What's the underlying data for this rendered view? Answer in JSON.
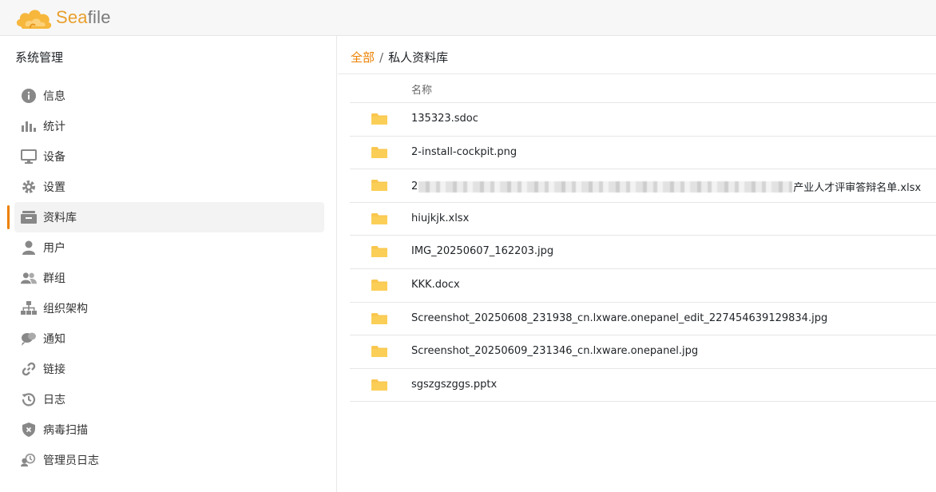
{
  "app": {
    "logo_text_a": "Sea",
    "logo_text_b": "file"
  },
  "sidebar": {
    "title": "系统管理",
    "items": [
      {
        "label": "信息",
        "icon": "info-icon"
      },
      {
        "label": "统计",
        "icon": "bar-chart-icon"
      },
      {
        "label": "设备",
        "icon": "monitor-icon"
      },
      {
        "label": "设置",
        "icon": "gear-icon"
      },
      {
        "label": "资料库",
        "icon": "library-icon",
        "active": true
      },
      {
        "label": "用户",
        "icon": "user-icon"
      },
      {
        "label": "群组",
        "icon": "group-icon"
      },
      {
        "label": "组织架构",
        "icon": "org-chart-icon"
      },
      {
        "label": "通知",
        "icon": "notification-icon"
      },
      {
        "label": "链接",
        "icon": "link-icon"
      },
      {
        "label": "日志",
        "icon": "history-icon"
      },
      {
        "label": "病毒扫描",
        "icon": "shield-icon"
      },
      {
        "label": "管理员日志",
        "icon": "admin-log-icon"
      }
    ]
  },
  "breadcrumb": {
    "root": "全部",
    "separator": "/",
    "current": "私人资料库"
  },
  "table": {
    "header_name": "名称",
    "rows": [
      {
        "name": "135323.sdoc"
      },
      {
        "name": "2-install-cockpit.png"
      },
      {
        "name_prefix": "2",
        "name_suffix": "产业人才评审答辩名单.xlsx"
      },
      {
        "name": "hiujkjk.xlsx"
      },
      {
        "name": "IMG_20250607_162203.jpg"
      },
      {
        "name": "KKK.docx"
      },
      {
        "name": "Screenshot_20250608_231938_cn.lxware.onepanel_edit_227454639129834.jpg"
      },
      {
        "name": "Screenshot_20250609_231346_cn.lxware.onepanel.jpg"
      },
      {
        "name": "sgszgszggs.pptx"
      }
    ]
  },
  "colors": {
    "accent": "#ec8000",
    "folder": "#f9c74f"
  }
}
